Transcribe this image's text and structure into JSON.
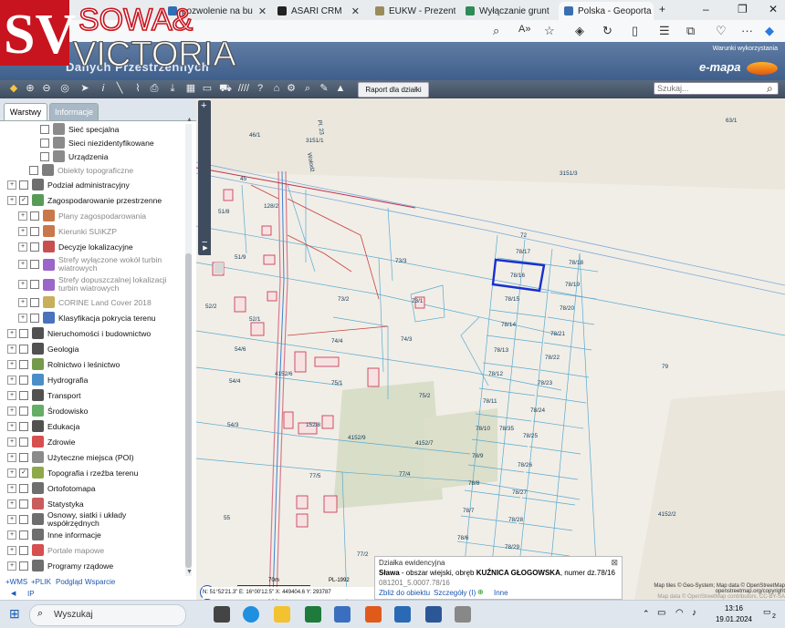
{
  "browser": {
    "tabs": [
      {
        "label": "pozwolenie na bu",
        "fav": "#2f6db5"
      },
      {
        "label": "ASARI CRM",
        "fav": "#222222"
      },
      {
        "label": "EUKW - Prezenta",
        "fav": "#9a8b5a"
      },
      {
        "label": "Wyłączanie grunt",
        "fav": "#2e8b57"
      },
      {
        "label": "Polska - Geoporta",
        "fav": "#3a6fb0"
      }
    ],
    "new_tab": "+",
    "controls": {
      "minimize": "–",
      "restore": "❐",
      "close": "✕"
    },
    "more": "···"
  },
  "watermark": {
    "line1": "SOWA&",
    "line2": "VICTORIA",
    "mark": "SV"
  },
  "site": {
    "subtitle": "Danych Przestrzennych",
    "terms_link": "Warunki wykorzystania",
    "brand": "e-mapa"
  },
  "toolbar": {
    "raport_button": "Raport dla działki",
    "search_placeholder": "Szukaj..."
  },
  "panel": {
    "tabs": [
      "Warstwy",
      "Informacje"
    ],
    "layers": [
      {
        "label": "Sieć specjalna",
        "indent": 3,
        "exp": false,
        "checked": false,
        "dim": false,
        "icon": "special-network-icon",
        "color": "#777"
      },
      {
        "label": "Sieci niezidentyfikowane",
        "indent": 3,
        "exp": false,
        "checked": false,
        "dim": false,
        "icon": "network-icon",
        "color": "#777"
      },
      {
        "label": "Urządzenia",
        "indent": 3,
        "exp": false,
        "checked": false,
        "dim": false,
        "icon": "device-icon",
        "color": "#777"
      },
      {
        "label": "Obiekty topograficzne",
        "indent": 2,
        "exp": false,
        "checked": false,
        "dim": true,
        "icon": "topo-object-icon",
        "color": "#666"
      },
      {
        "label": "Podział administracyjny",
        "indent": 0,
        "exp": true,
        "checked": false,
        "dim": false,
        "icon": "admin-division-icon",
        "color": "#555"
      },
      {
        "label": "Zagospodarowanie przestrzenne",
        "indent": 0,
        "exp": true,
        "checked": true,
        "dim": false,
        "icon": "spatial-planning-icon",
        "color": "#3a8a3a"
      },
      {
        "label": "Plany zagospodarowania",
        "indent": 1,
        "exp": true,
        "checked": false,
        "dim": true,
        "icon": "plans-icon",
        "color": "#c0602a"
      },
      {
        "label": "Kierunki SUiKZP",
        "indent": 1,
        "exp": true,
        "checked": false,
        "dim": true,
        "icon": "directions-icon",
        "color": "#c0602a"
      },
      {
        "label": "Decyzje lokalizacyjne",
        "indent": 1,
        "exp": true,
        "checked": false,
        "dim": false,
        "icon": "decisions-icon",
        "color": "#c03030"
      },
      {
        "label": "Strefy wyłączone wokół turbin wiatrowych",
        "indent": 1,
        "exp": true,
        "checked": false,
        "dim": true,
        "icon": "turbine-exclusion-icon",
        "color": "#8a4ac0"
      },
      {
        "label": "Strefy dopuszczalnej lokalizacji turbin wiatrowych",
        "indent": 1,
        "exp": true,
        "checked": false,
        "dim": true,
        "icon": "turbine-zone-icon",
        "color": "#8a4ac0"
      },
      {
        "label": "CORINE Land Cover 2018",
        "indent": 1,
        "exp": true,
        "checked": false,
        "dim": true,
        "icon": "corine-icon",
        "color": "#c0a040"
      },
      {
        "label": "Klasyfikacja pokrycia terenu",
        "indent": 1,
        "exp": true,
        "checked": false,
        "dim": false,
        "icon": "land-cover-icon",
        "color": "#2a5ab0"
      },
      {
        "label": "Nieruchomości i budownictwo",
        "indent": 0,
        "exp": true,
        "checked": false,
        "dim": false,
        "icon": "building-icon",
        "color": "#333"
      },
      {
        "label": "Geologia",
        "indent": 0,
        "exp": true,
        "checked": false,
        "dim": false,
        "icon": "geology-icon",
        "color": "#333"
      },
      {
        "label": "Rolnictwo i leśnictwo",
        "indent": 0,
        "exp": true,
        "checked": false,
        "dim": false,
        "icon": "agriculture-icon",
        "color": "#5a8a2a"
      },
      {
        "label": "Hydrografia",
        "indent": 0,
        "exp": true,
        "checked": false,
        "dim": false,
        "icon": "hydrography-icon",
        "color": "#2a7ac0"
      },
      {
        "label": "Transport",
        "indent": 0,
        "exp": true,
        "checked": false,
        "dim": false,
        "icon": "transport-icon",
        "color": "#333"
      },
      {
        "label": "Środowisko",
        "indent": 0,
        "exp": true,
        "checked": false,
        "dim": false,
        "icon": "environment-icon",
        "color": "#4aa04a"
      },
      {
        "label": "Edukacja",
        "indent": 0,
        "exp": true,
        "checked": false,
        "dim": false,
        "icon": "education-icon",
        "color": "#333"
      },
      {
        "label": "Zdrowie",
        "indent": 0,
        "exp": true,
        "checked": false,
        "dim": false,
        "icon": "health-icon",
        "color": "#d03030"
      },
      {
        "label": "Użyteczne miejsca (POI)",
        "indent": 0,
        "exp": true,
        "checked": false,
        "dim": false,
        "icon": "poi-icon",
        "color": "#777"
      },
      {
        "label": "Topografia i rzeźba terenu",
        "indent": 0,
        "exp": true,
        "checked": true,
        "dim": false,
        "icon": "topography-icon",
        "color": "#7a9a2a"
      },
      {
        "label": "Ortofotomapa",
        "indent": 0,
        "exp": true,
        "checked": false,
        "dim": false,
        "icon": "orthophoto-icon",
        "color": "#555"
      },
      {
        "label": "Statystyka",
        "indent": 0,
        "exp": true,
        "checked": false,
        "dim": false,
        "icon": "statistics-icon",
        "color": "#c04040"
      },
      {
        "label": "Osnowy, siatki i układy współrzędnych",
        "indent": 0,
        "exp": true,
        "checked": false,
        "dim": false,
        "icon": "grid-icon",
        "color": "#555"
      },
      {
        "label": "Inne informacje",
        "indent": 0,
        "exp": true,
        "checked": false,
        "dim": false,
        "icon": "info-icon",
        "color": "#555"
      },
      {
        "label": "Portale mapowe",
        "indent": 0,
        "exp": true,
        "checked": false,
        "dim": true,
        "icon": "map-portal-icon",
        "color": "#d03030"
      },
      {
        "label": "Programy rządowe",
        "indent": 0,
        "exp": true,
        "checked": false,
        "dim": false,
        "icon": "government-icon",
        "color": "#555"
      }
    ],
    "footer_links": [
      "+WMS",
      "+PLIK",
      "Podgląd",
      "Wsparcie"
    ],
    "ip_label": "IP"
  },
  "map": {
    "selected_parcel": "78/16",
    "parcels": [
      "63/1",
      "46/1",
      "3151/3",
      "3151/1",
      "128/2",
      "51/8",
      "72",
      "78/17",
      "78/18",
      "78/16",
      "78/19",
      "73/3",
      "73/2",
      "73/1",
      "78/15",
      "78/20",
      "52/2",
      "51/9",
      "52/1",
      "78/14",
      "78/21",
      "74/4",
      "74/3",
      "54/6",
      "78/13",
      "78/22",
      "4152/6",
      "75/1",
      "78/12",
      "79",
      "54/4",
      "78/23",
      "75/2",
      "78/11",
      "78/24",
      "54/3",
      "152/8",
      "78/10",
      "78/35",
      "4152/9",
      "4152/7",
      "78/25",
      "78/9",
      "77/5",
      "77/4",
      "78/26",
      "78/8",
      "78/27",
      "55",
      "78/7",
      "4152/2",
      "78/28",
      "78/6",
      "78/29",
      "77/2"
    ],
    "road_label": "Wołodź",
    "road_label_2": "Pl. 23",
    "road_45": "45",
    "scale_label": "70m",
    "coord_ref": "PL-1992",
    "coordinates": "N: 51°52'21.3\" E: 16°00'12.5\"  X: 449404.6  Y: 293787",
    "attribution_1": "Map tiles © Geo-System; Map data © OpenStreetMap",
    "attribution_2": "openstreetmap.org/copyright",
    "attribution_3": "Map data © OpenStreetMap contributors, CC-BY-SA",
    "ok_button": "ok"
  },
  "popup": {
    "title": "Działka ewidencyjna",
    "line1_place": "Sława",
    "line1_rest": " - obszar wiejski, obręb ",
    "line1_obreb": "KUŹNICA GŁOGOWSKA",
    "line1_tail": ", numer dz.78/16",
    "code": "081201_5.0007.78/16",
    "links": [
      "Zbliż do obiektu",
      "Szczegóły (I)",
      "Inne"
    ]
  },
  "taskbar": {
    "search": "Wyszukaj",
    "time": "13:16",
    "date": "19.01.2024",
    "notifications": "2"
  }
}
